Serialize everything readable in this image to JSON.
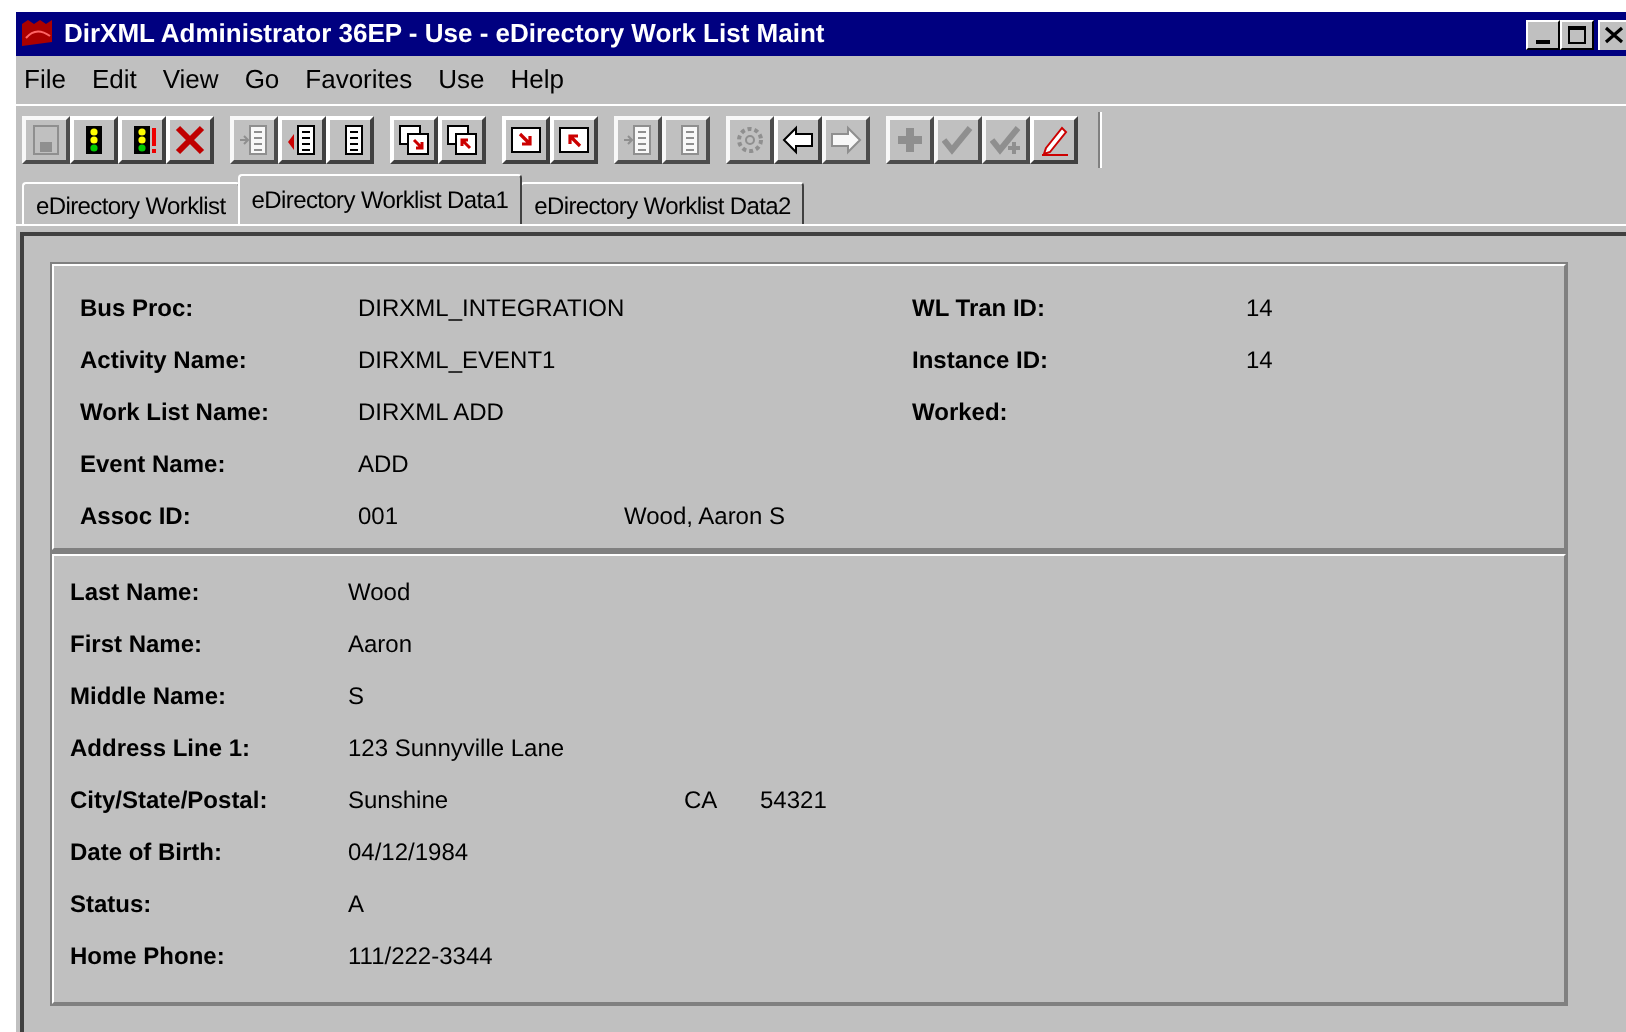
{
  "window": {
    "title": "DirXML Administrator 36EP - Use - eDirectory Work List Maint"
  },
  "menu": [
    "File",
    "Edit",
    "View",
    "Go",
    "Favorites",
    "Use",
    "Help"
  ],
  "toolbar": [
    [
      {
        "kind": "save",
        "disabled": true
      },
      {
        "kind": "light",
        "disabled": false
      },
      {
        "kind": "light-alert",
        "disabled": false
      },
      {
        "kind": "delete",
        "disabled": false
      }
    ],
    [
      {
        "kind": "list-down",
        "disabled": true
      },
      {
        "kind": "list-up",
        "disabled": false
      },
      {
        "kind": "list",
        "disabled": false
      }
    ],
    [
      {
        "kind": "window-down",
        "disabled": false
      },
      {
        "kind": "window-up",
        "disabled": false
      }
    ],
    [
      {
        "kind": "box-down",
        "disabled": false
      },
      {
        "kind": "box-up",
        "disabled": false
      }
    ],
    [
      {
        "kind": "list-in",
        "disabled": true
      },
      {
        "kind": "list-out",
        "disabled": true
      }
    ],
    [
      {
        "kind": "gear",
        "disabled": true
      },
      {
        "kind": "back",
        "disabled": false
      },
      {
        "kind": "forward",
        "disabled": true
      }
    ],
    [
      {
        "kind": "plus",
        "disabled": true
      },
      {
        "kind": "check",
        "disabled": true
      },
      {
        "kind": "check-plus",
        "disabled": true
      },
      {
        "kind": "pencil",
        "disabled": false
      }
    ]
  ],
  "tabs": [
    {
      "label": "eDirectory Worklist",
      "selected": false
    },
    {
      "label": "eDirectory Worklist Data1",
      "selected": true
    },
    {
      "label": "eDirectory Worklist Data2",
      "selected": false
    }
  ],
  "header_fields": [
    {
      "label": "Bus Proc:",
      "value": "DIRXML_INTEGRATION",
      "right_label": "WL Tran ID:",
      "right_value": "14"
    },
    {
      "label": "Activity Name:",
      "value": "DIRXML_EVENT1",
      "right_label": "Instance ID:",
      "right_value": "14"
    },
    {
      "label": "Work List Name:",
      "value": "DIRXML ADD",
      "right_label": "Worked:"
    },
    {
      "label": "Event Name:",
      "value": "ADD"
    },
    {
      "label": "Assoc ID:",
      "value": "001",
      "extra": "Wood, Aaron S"
    }
  ],
  "person_fields": [
    {
      "label": "Last Name:",
      "value": "Wood"
    },
    {
      "label": "First Name:",
      "value": "Aaron"
    },
    {
      "label": "Middle Name:",
      "value": "S"
    },
    {
      "label": "Address Line 1:",
      "value": "123 Sunnyville Lane"
    },
    {
      "label": "City/State/Postal:",
      "value": "Sunshine",
      "state": "CA",
      "postal": "54321"
    },
    {
      "label": "Date of Birth:",
      "value": "04/12/1984"
    },
    {
      "label": "Status:",
      "value": "A"
    },
    {
      "label": "Home Phone:",
      "value": "111/222-3344"
    }
  ]
}
